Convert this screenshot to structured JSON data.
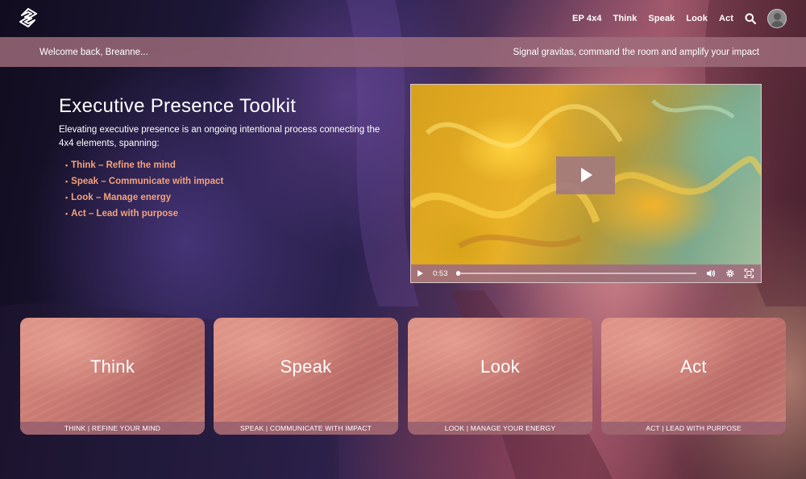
{
  "nav": {
    "items": [
      "EP 4x4",
      "Think",
      "Speak",
      "Look",
      "Act"
    ]
  },
  "banner": {
    "welcome": "Welcome back, Breanne...",
    "tagline": "Signal gravitas, command the room and amplify your impact"
  },
  "intro": {
    "title": "Executive Presence Toolkit",
    "description": "Elevating executive presence is an ongoing intentional process connecting the 4x4 elements, spanning:",
    "bullets": [
      "Think – Refine the mind",
      "Speak – Communicate with impact",
      "Look – Manage energy",
      "Act – Lead with purpose"
    ]
  },
  "video": {
    "time": "0:53",
    "progress": 0.0
  },
  "cards": [
    {
      "title": "Think",
      "caption": "THINK | REFINE YOUR MIND"
    },
    {
      "title": "Speak",
      "caption": "SPEAK | COMMUNICATE WITH IMPACT"
    },
    {
      "title": "Look",
      "caption": "LOOK | MANAGE YOUR ENERGY"
    },
    {
      "title": "Act",
      "caption": "ACT | LEAD WITH PURPOSE"
    }
  ],
  "colors": {
    "accent": "#f4a27c",
    "banner": "#a06e7d",
    "card": "#c97a72"
  },
  "icons": [
    "logo-icon",
    "search-icon",
    "avatar",
    "play-icon",
    "volume-icon",
    "settings-icon",
    "fullscreen-icon"
  ]
}
